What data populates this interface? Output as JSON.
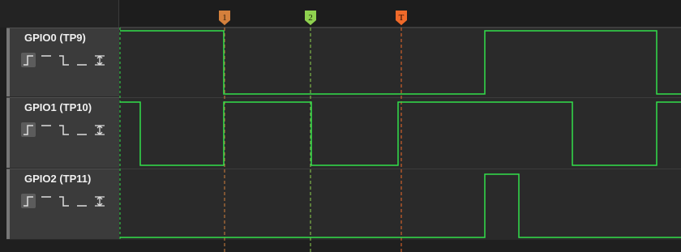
{
  "channels": [
    {
      "name": "GPIO0 (TP9)",
      "levels": [
        1,
        0,
        1,
        0
      ]
    },
    {
      "name": "GPIO1 (TP10)",
      "levels": [
        1,
        0,
        1,
        0,
        1,
        0,
        1
      ]
    },
    {
      "name": "GPIO2 (TP11)",
      "levels": [
        0,
        1,
        0
      ]
    }
  ],
  "markers": [
    {
      "label": "1",
      "color": "#d4803c"
    },
    {
      "label": "2",
      "color": "#8fd14f"
    },
    {
      "label": "T",
      "color": "#f06a2a"
    }
  ],
  "trigger_icons": [
    "rising-edge-icon",
    "high-level-icon",
    "falling-edge-icon",
    "low-level-icon",
    "any-edge-icon"
  ],
  "colors": {
    "signal": "#33e04a",
    "background": "#2a2a2a"
  }
}
